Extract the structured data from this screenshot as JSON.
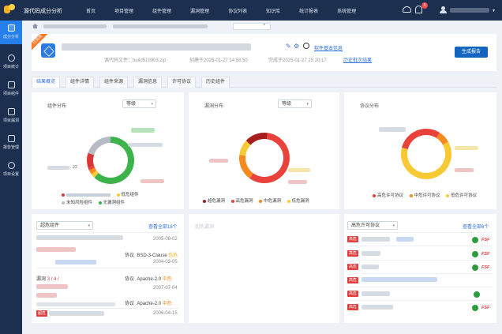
{
  "app": {
    "title": "源代码成分分析"
  },
  "nav": [
    "首页",
    "项目管理",
    "组件管理",
    "漏洞管理",
    "协议列表",
    "知识库",
    "统计报表",
    "系统管理"
  ],
  "notifications": {
    "count": "5"
  },
  "sidebar": [
    {
      "label": "成分分析",
      "active": true
    },
    {
      "label": "项目统计"
    },
    {
      "label": "项目组件"
    },
    {
      "label": "项目漏洞"
    },
    {
      "label": "报告管理"
    },
    {
      "label": "项目设置"
    }
  ],
  "project": {
    "ribbon": "已完成",
    "basic_info_link": "软件基本信息",
    "source_file": "源代码文件：build519903.zip",
    "created": "创建于2025-01-27 14:58:50",
    "completed": "完成于2025-01-27 15:20:17",
    "history_link": "历史批次结果",
    "generate_button": "生成报告"
  },
  "tabs": [
    {
      "label": "结果概览",
      "active": true
    },
    {
      "label": "组件详情"
    },
    {
      "label": "组件来源"
    },
    {
      "label": "漏洞信息"
    },
    {
      "label": "许可协议"
    },
    {
      "label": "历史组件"
    }
  ],
  "colors": {
    "critical": "#d93737",
    "high": "#e8423a",
    "medium": "#f58a1f",
    "low": "#f7c934",
    "safe": "#3cb44b",
    "unknown": "#b7bcc4",
    "accent": "#1565c0"
  },
  "panels": {
    "component": {
      "title": "组件分布",
      "select": "等级",
      "small_label": "22",
      "legend": [
        "低危组件",
        "未知风险组件",
        "无漏洞组件"
      ]
    },
    "vulnerability": {
      "title": "漏洞分布",
      "select": "等级",
      "legend": [
        "超危漏洞",
        "高危漏洞",
        "中危漏洞",
        "低危漏洞"
      ]
    },
    "license": {
      "title": "协议分布",
      "legend": [
        "高危许可协议",
        "中危许可协议",
        "低危许可协议"
      ]
    }
  },
  "chart_data": [
    {
      "type": "pie",
      "title": "组件分布",
      "labels": [
        "无漏洞组件",
        "低危组件",
        "中危组件",
        "高危组件",
        "超危组件",
        "未知风险组件"
      ],
      "values": [
        62,
        3,
        3,
        2,
        10,
        20
      ]
    },
    {
      "type": "pie",
      "title": "漏洞分布",
      "labels": [
        "超危漏洞",
        "高危漏洞",
        "中危漏洞",
        "低危漏洞"
      ],
      "values": [
        15,
        58,
        17,
        10
      ]
    },
    {
      "type": "pie",
      "title": "协议分布",
      "labels": [
        "高危许可协议",
        "中危许可协议",
        "低危许可协议"
      ],
      "values": [
        30,
        8,
        62
      ]
    }
  ],
  "bottom_left": {
    "select": "超危组件",
    "more_link": "查看全部18个",
    "rows": [
      {
        "date": "2005-08-02"
      },
      {
        "protocol_label": "协议",
        "protocol": "BSD-3-Clause",
        "level": "低危",
        "date": "2004-03-05"
      },
      {
        "vuln_label": "漏洞",
        "vuln_count": "3 / 4 /",
        "protocol_label": "协议",
        "protocol": "Apache-2.0",
        "level": "中危"
      },
      {
        "date": "2007-07-04"
      },
      {
        "protocol_label": "协议",
        "protocol": "Apache-2.0",
        "level": "中危"
      },
      {
        "tag": "超危",
        "date": "2006-04-15"
      }
    ]
  },
  "bottom_mid": {
    "placeholder": "超危漏洞"
  },
  "bottom_right": {
    "select": "高危许可协议",
    "more_link": "查看全部6个",
    "rows": [
      {
        "tag": "高危",
        "fsf": "FSF"
      },
      {
        "tag": "高危",
        "fsf": "FSF"
      },
      {
        "tag": "高危",
        "fsf": "FSF"
      },
      {
        "tag": "高危"
      },
      {
        "tag": "高危"
      },
      {
        "tag": "高危",
        "fsf": "FSF"
      }
    ]
  }
}
